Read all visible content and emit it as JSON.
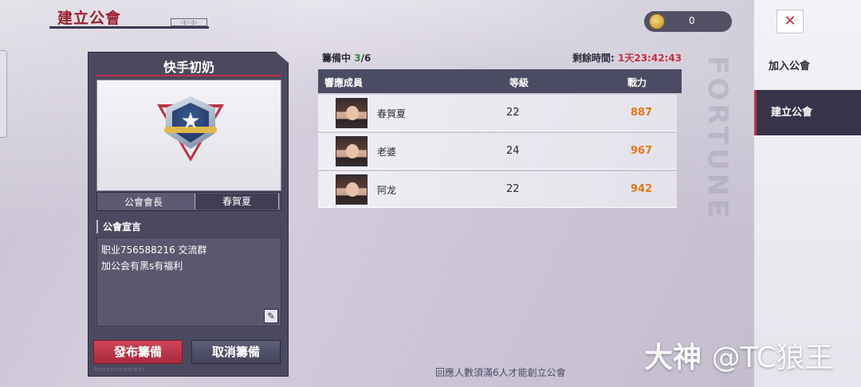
{
  "header": {
    "title": "建立公會"
  },
  "currency": {
    "amount": "0"
  },
  "guild": {
    "name": "快手初奶",
    "leader_label": "公會會長",
    "leader_value": "春賀夏",
    "declaration_title": "公會宣言",
    "declaration_text": "职业756588216 交流群\n加公会有黑s有福利"
  },
  "buttons": {
    "publish": "發布籌備",
    "cancel": "取消籌備"
  },
  "prep": {
    "label": "籌備中",
    "current": "3",
    "total": "/6",
    "time_label": "剩餘時間:",
    "time_value": "1天23:42:43"
  },
  "table": {
    "headers": {
      "member": "響應成員",
      "level": "等級",
      "power": "戰力"
    },
    "rows": [
      {
        "name": "春賀夏",
        "level": "22",
        "power": "887"
      },
      {
        "name": "老婆",
        "level": "24",
        "power": "967"
      },
      {
        "name": "阿龙",
        "level": "22",
        "power": "942"
      }
    ]
  },
  "notice": "回應人數須滿6人才能創立公會",
  "menu": {
    "join": "加入公會",
    "create": "建立公會"
  },
  "watermark": {
    "brand": "大神",
    "handle": "@TC狼王"
  },
  "colors": {
    "accent_red": "#c0324a",
    "power_orange": "#e07a16",
    "count_green": "#2f8a3a"
  }
}
